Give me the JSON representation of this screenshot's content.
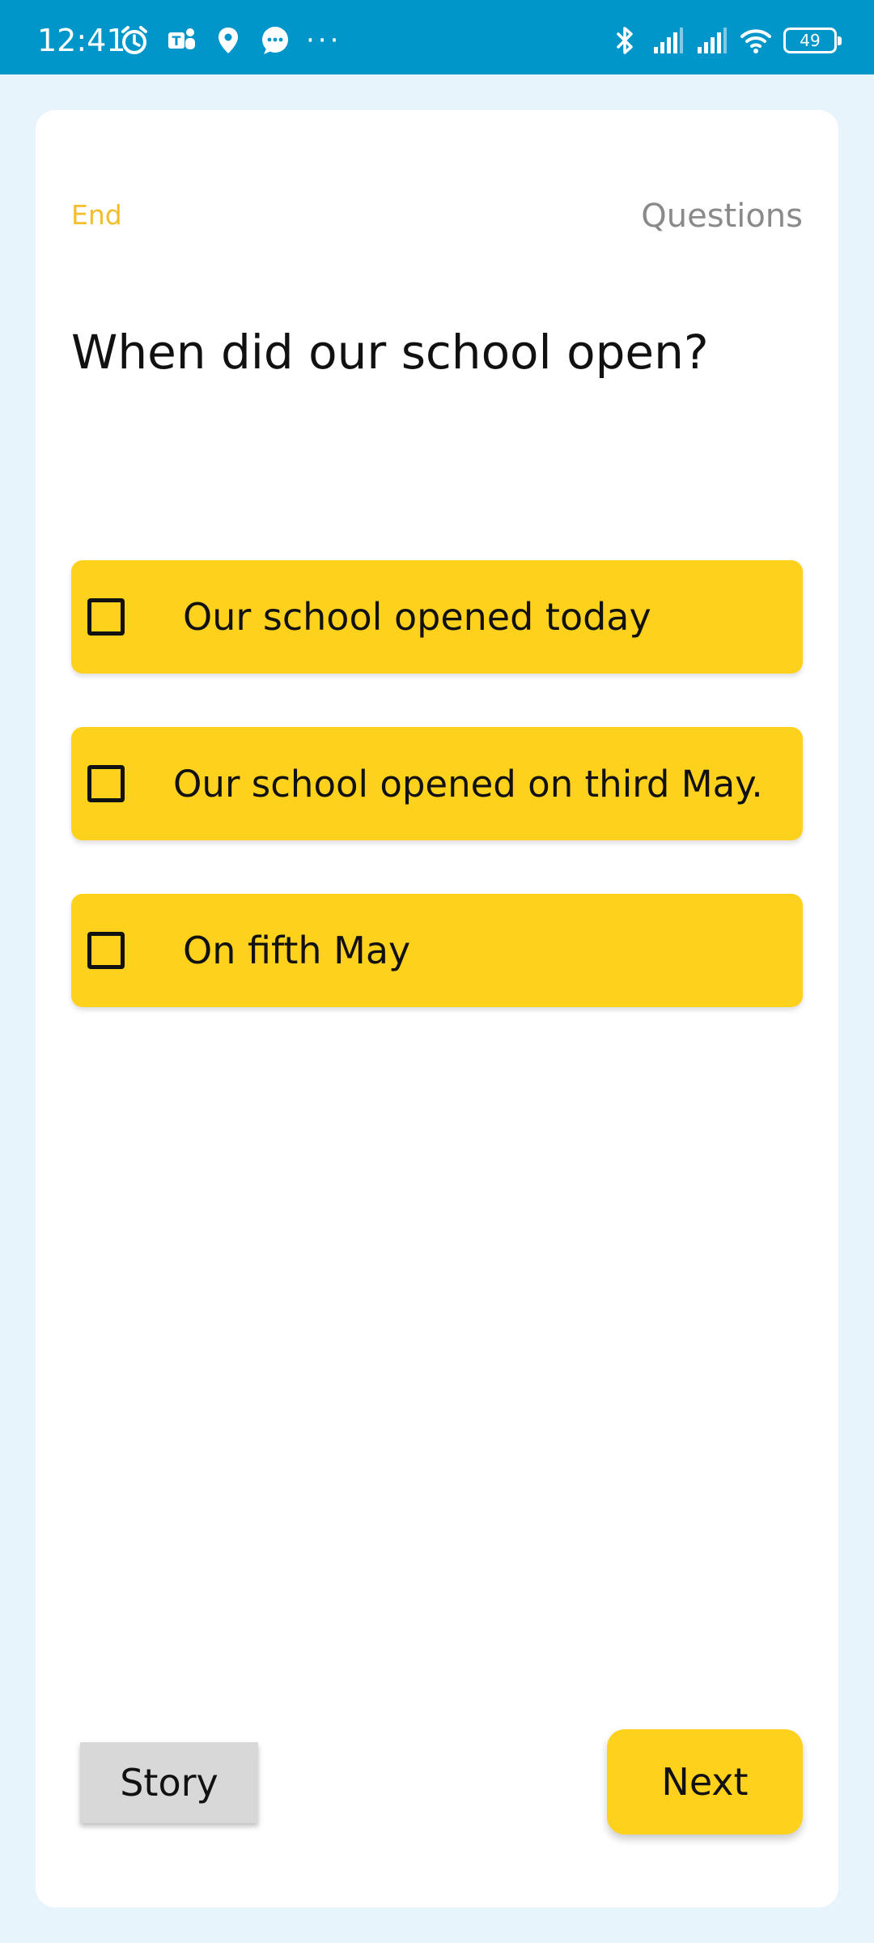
{
  "status_bar": {
    "time": "12:41",
    "left_icons": [
      "alarm-icon",
      "teams-icon",
      "location-icon",
      "chat-bubble-icon"
    ],
    "overflow": "···",
    "right_icons": [
      "bluetooth-icon",
      "signal-icon",
      "signal-icon",
      "wifi-icon"
    ],
    "battery": "49",
    "background": "#0096c9"
  },
  "header": {
    "end_label": "End",
    "questions_label": "Questions"
  },
  "question": {
    "text": "When did our school open?"
  },
  "options": [
    {
      "label": "Our school opened today",
      "checked": false
    },
    {
      "label": "Our school opened on third May.",
      "checked": false
    },
    {
      "label": "On fifth May",
      "checked": false
    }
  ],
  "footer": {
    "story_label": "Story",
    "next_label": "Next"
  },
  "colors": {
    "accent": "#fdd11c",
    "end_link": "#f5bd2a",
    "page_background": "#e8f4fb"
  }
}
